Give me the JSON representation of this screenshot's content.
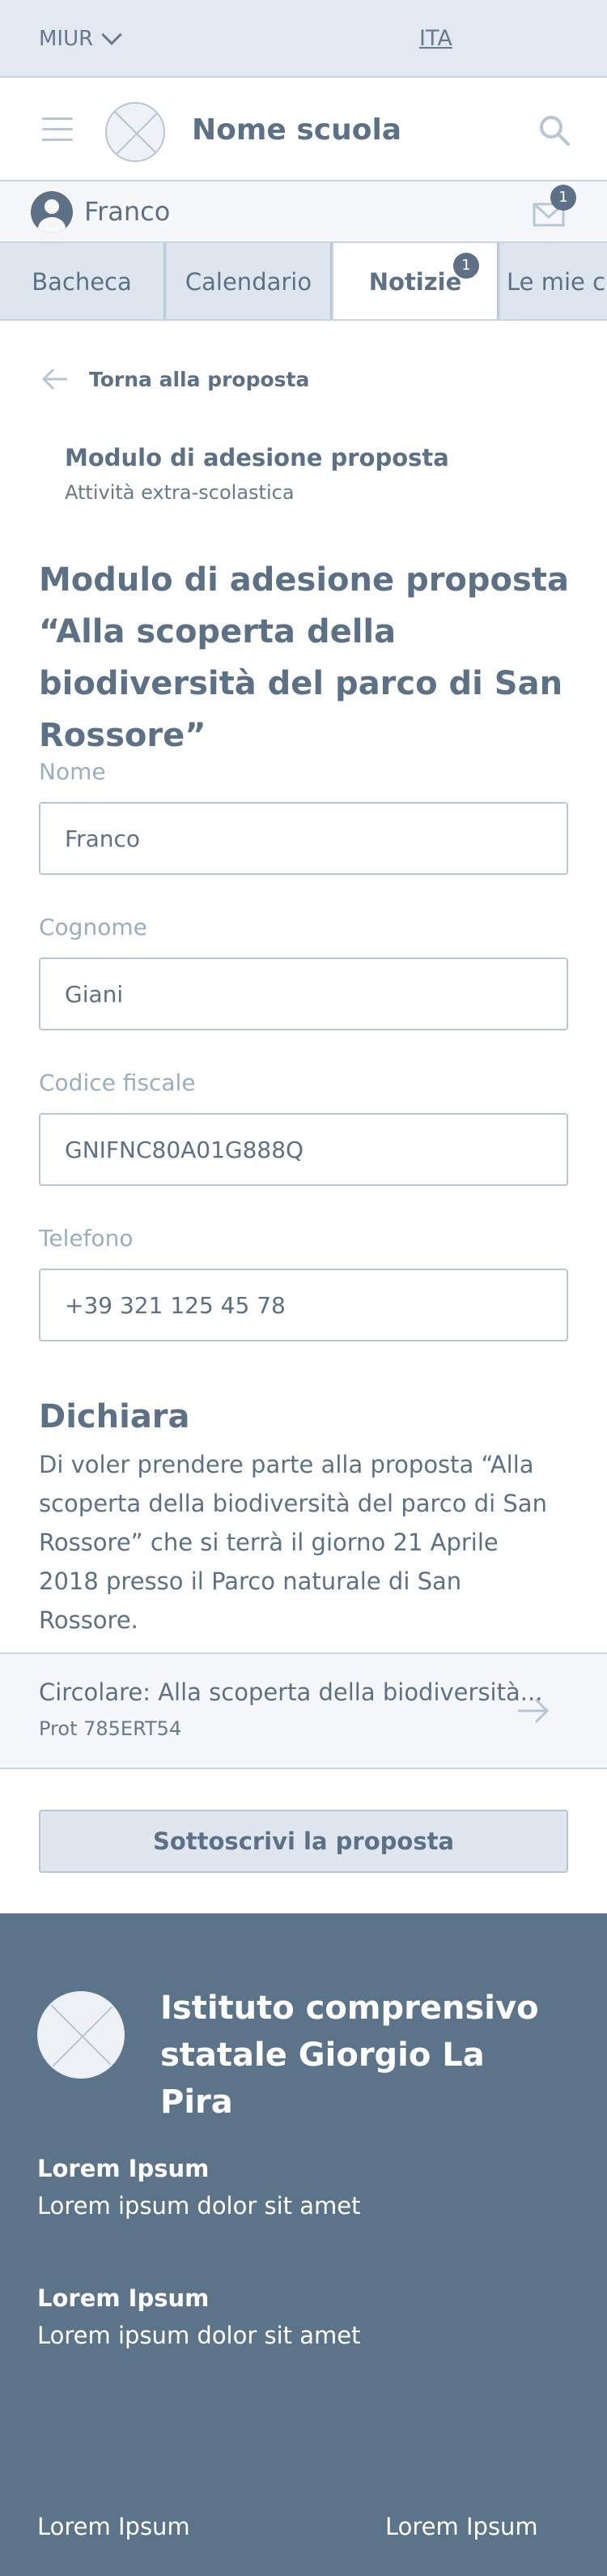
{
  "topbar": {
    "org": "MIUR",
    "lang": "ITA"
  },
  "header": {
    "school_name": "Nome scuola"
  },
  "user": {
    "name": "Franco",
    "mail_count": "1"
  },
  "tabs": [
    {
      "label": "Bacheca"
    },
    {
      "label": "Calendario"
    },
    {
      "label": "Notizie",
      "badge": "1"
    },
    {
      "label": "Le mie classi"
    }
  ],
  "back": {
    "label": "Torna alla proposta"
  },
  "context": {
    "title": "Modulo di adesione proposta",
    "subtitle": "Attività extra-scolastica"
  },
  "page_title": "Modulo di adesione proposta “Alla scoperta della biodiversità del parco di San Rossore”",
  "fields": [
    {
      "label": "Nome",
      "value": "Franco"
    },
    {
      "label": "Cognome",
      "value": "Giani"
    },
    {
      "label": "Codice fiscale",
      "value": "GNIFNC80A01G888Q"
    },
    {
      "label": "Telefono",
      "value": "+39 321 125 45 78"
    }
  ],
  "dichiara": {
    "title": "Dichiara",
    "text": "Di voler prendere parte alla proposta “Alla scoperta della biodiversità del parco di San Rossore” che si terrà il giorno 21 Aprile 2018 presso il Parco naturale di San Rossore."
  },
  "circolare": {
    "title": "Circolare: Alla scoperta della biodiversità...",
    "prot": "Prot 785ERT54"
  },
  "submit_label": "Sottoscrivi la proposta",
  "footer": {
    "institute": "Istituto comprensivo statale Giorgio La Pira",
    "blocks": [
      {
        "heading": "Lorem Ipsum",
        "text": "Lorem ipsum dolor sit amet"
      },
      {
        "heading": "Lorem Ipsum",
        "text": "Lorem ipsum dolor sit amet"
      }
    ],
    "bottom_left": "Lorem Ipsum",
    "bottom_right": "Lorem Ipsum"
  },
  "colors": {
    "primary": "#5c7185",
    "footer_bg": "#5b7489",
    "border": "#b7c6d4",
    "tab_bg": "#dde5ee"
  }
}
